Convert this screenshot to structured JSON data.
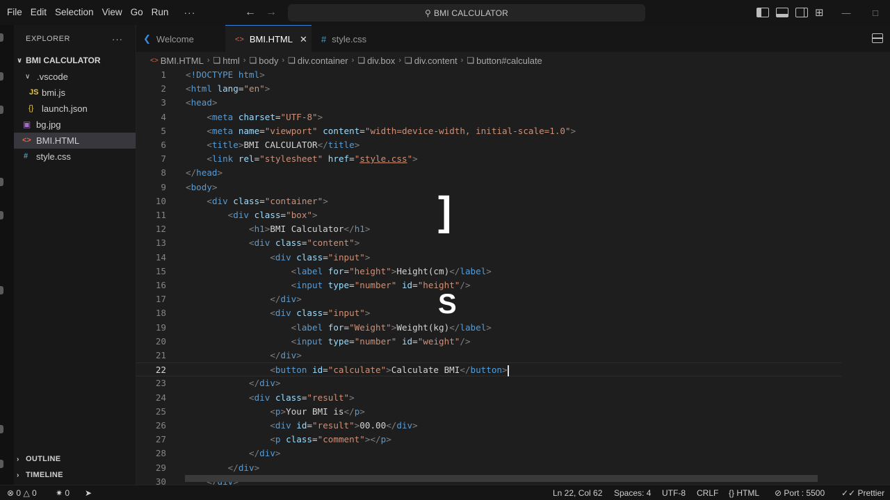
{
  "titlebar": {
    "menu": [
      "File",
      "Edit",
      "Selection",
      "View",
      "Go",
      "Run"
    ],
    "more": "···",
    "command_center": "BMI CALCULATOR"
  },
  "sidebar": {
    "title": "EXPLORER",
    "more": "···",
    "project": "BMI CALCULATOR",
    "items": [
      {
        "label": ".vscode",
        "icon": "chevron-down-icon",
        "indent": 1
      },
      {
        "label": "bmi.js",
        "icon": "js-file-icon",
        "badge": "JS",
        "indent": 2
      },
      {
        "label": "launch.json",
        "icon": "json-file-icon",
        "badge": "{}",
        "indent": 2
      },
      {
        "label": "bg.jpg",
        "icon": "image-file-icon",
        "badge": "▣",
        "indent": 1
      },
      {
        "label": "BMI.HTML",
        "icon": "html-file-icon",
        "badge": "<>",
        "indent": 1,
        "active": true
      },
      {
        "label": "style.css",
        "icon": "css-file-icon",
        "badge": "#",
        "indent": 1
      }
    ],
    "outline": "OUTLINE",
    "timeline": "TIMELINE"
  },
  "tabs": [
    {
      "label": "Welcome",
      "icon": "vscode-icon"
    },
    {
      "label": "BMI.HTML",
      "icon": "html-file-icon",
      "active": true,
      "close": "✕"
    },
    {
      "label": "style.css",
      "icon": "css-file-icon"
    }
  ],
  "breadcrumb": [
    "BMI.HTML",
    "html",
    "body",
    "div.container",
    "div.box",
    "div.content",
    "button#calculate"
  ],
  "editor": {
    "current_line": 22,
    "overlay_glyphs": [
      "]",
      "S"
    ],
    "lines": [
      {
        "n": "1",
        "tokens": [
          [
            "pun",
            "<"
          ],
          [
            "tag",
            "!DOCTYPE "
          ],
          [
            "kw",
            "html"
          ],
          [
            "pun",
            ">"
          ]
        ]
      },
      {
        "n": "2",
        "tokens": [
          [
            "pun",
            "<"
          ],
          [
            "tag",
            "html "
          ],
          [
            "attr",
            "lang"
          ],
          [
            "txt",
            "="
          ],
          [
            "str",
            "\"en\""
          ],
          [
            "pun",
            ">"
          ]
        ]
      },
      {
        "n": "3",
        "tokens": [
          [
            "pun",
            "<"
          ],
          [
            "tag",
            "head"
          ],
          [
            "pun",
            ">"
          ]
        ]
      },
      {
        "n": "4",
        "tokens": [
          [
            "txt",
            "    "
          ],
          [
            "pun",
            "<"
          ],
          [
            "tag",
            "meta "
          ],
          [
            "attr",
            "charset"
          ],
          [
            "txt",
            "="
          ],
          [
            "str",
            "\"UTF-8\""
          ],
          [
            "pun",
            ">"
          ]
        ]
      },
      {
        "n": "5",
        "tokens": [
          [
            "txt",
            "    "
          ],
          [
            "pun",
            "<"
          ],
          [
            "tag",
            "meta "
          ],
          [
            "attr",
            "name"
          ],
          [
            "txt",
            "="
          ],
          [
            "str",
            "\"viewport\" "
          ],
          [
            "attr",
            "content"
          ],
          [
            "txt",
            "="
          ],
          [
            "str",
            "\"width=device-width, initial-scale=1.0\""
          ],
          [
            "pun",
            ">"
          ]
        ]
      },
      {
        "n": "6",
        "tokens": [
          [
            "txt",
            "    "
          ],
          [
            "pun",
            "<"
          ],
          [
            "tag",
            "title"
          ],
          [
            "pun",
            ">"
          ],
          [
            "txt",
            "BMI CALCULATOR"
          ],
          [
            "pun",
            "</"
          ],
          [
            "tag",
            "title"
          ],
          [
            "pun",
            ">"
          ]
        ]
      },
      {
        "n": "7",
        "tokens": [
          [
            "txt",
            "    "
          ],
          [
            "pun",
            "<"
          ],
          [
            "tag",
            "link "
          ],
          [
            "attr",
            "rel"
          ],
          [
            "txt",
            "="
          ],
          [
            "str",
            "\"stylesheet\" "
          ],
          [
            "attr",
            "href"
          ],
          [
            "txt",
            "="
          ],
          [
            "str",
            "\""
          ],
          [
            "link",
            "style.css"
          ],
          [
            "str",
            "\""
          ],
          [
            "pun",
            ">"
          ]
        ]
      },
      {
        "n": "8",
        "tokens": [
          [
            "pun",
            "</"
          ],
          [
            "tag",
            "head"
          ],
          [
            "pun",
            ">"
          ]
        ]
      },
      {
        "n": "9",
        "tokens": [
          [
            "pun",
            "<"
          ],
          [
            "tag",
            "body"
          ],
          [
            "pun",
            ">"
          ]
        ]
      },
      {
        "n": "10",
        "tokens": [
          [
            "txt",
            "    "
          ],
          [
            "pun",
            "<"
          ],
          [
            "tag",
            "div "
          ],
          [
            "attr",
            "class"
          ],
          [
            "txt",
            "="
          ],
          [
            "str",
            "\"container\""
          ],
          [
            "pun",
            ">"
          ]
        ]
      },
      {
        "n": "11",
        "tokens": [
          [
            "txt",
            "        "
          ],
          [
            "pun",
            "<"
          ],
          [
            "tag",
            "div "
          ],
          [
            "attr",
            "class"
          ],
          [
            "txt",
            "="
          ],
          [
            "str",
            "\"box\""
          ],
          [
            "pun",
            ">"
          ]
        ]
      },
      {
        "n": "12",
        "tokens": [
          [
            "txt",
            "            "
          ],
          [
            "pun",
            "<"
          ],
          [
            "tag",
            "h1"
          ],
          [
            "pun",
            ">"
          ],
          [
            "txt",
            "BMI Calculator"
          ],
          [
            "pun",
            "</"
          ],
          [
            "tag",
            "h1"
          ],
          [
            "pun",
            ">"
          ]
        ]
      },
      {
        "n": "13",
        "tokens": [
          [
            "txt",
            "            "
          ],
          [
            "pun",
            "<"
          ],
          [
            "tag",
            "div "
          ],
          [
            "attr",
            "class"
          ],
          [
            "txt",
            "="
          ],
          [
            "str",
            "\"content\""
          ],
          [
            "pun",
            ">"
          ]
        ]
      },
      {
        "n": "14",
        "tokens": [
          [
            "txt",
            "                "
          ],
          [
            "pun",
            "<"
          ],
          [
            "tag",
            "div "
          ],
          [
            "attr",
            "class"
          ],
          [
            "txt",
            "="
          ],
          [
            "str",
            "\"input\""
          ],
          [
            "pun",
            ">"
          ]
        ]
      },
      {
        "n": "15",
        "tokens": [
          [
            "txt",
            "                    "
          ],
          [
            "pun",
            "<"
          ],
          [
            "tag",
            "label "
          ],
          [
            "attr",
            "for"
          ],
          [
            "txt",
            "="
          ],
          [
            "str",
            "\"height\""
          ],
          [
            "pun",
            ">"
          ],
          [
            "txt",
            "Height(cm)"
          ],
          [
            "pun",
            "</"
          ],
          [
            "tag",
            "label"
          ],
          [
            "pun",
            ">"
          ]
        ]
      },
      {
        "n": "16",
        "tokens": [
          [
            "txt",
            "                    "
          ],
          [
            "pun",
            "<"
          ],
          [
            "tag",
            "input "
          ],
          [
            "attr",
            "type"
          ],
          [
            "txt",
            "="
          ],
          [
            "str",
            "\"number\" "
          ],
          [
            "attr",
            "id"
          ],
          [
            "txt",
            "="
          ],
          [
            "str",
            "\"height\""
          ],
          [
            "pun",
            "/>"
          ]
        ]
      },
      {
        "n": "17",
        "tokens": [
          [
            "txt",
            "                "
          ],
          [
            "pun",
            "</"
          ],
          [
            "tag",
            "div"
          ],
          [
            "pun",
            ">"
          ]
        ]
      },
      {
        "n": "18",
        "tokens": [
          [
            "txt",
            "                "
          ],
          [
            "pun",
            "<"
          ],
          [
            "tag",
            "div "
          ],
          [
            "attr",
            "class"
          ],
          [
            "txt",
            "="
          ],
          [
            "str",
            "\"input\""
          ],
          [
            "pun",
            ">"
          ]
        ]
      },
      {
        "n": "19",
        "tokens": [
          [
            "txt",
            "                    "
          ],
          [
            "pun",
            "<"
          ],
          [
            "tag",
            "label "
          ],
          [
            "attr",
            "for"
          ],
          [
            "txt",
            "="
          ],
          [
            "str",
            "\"Weight\""
          ],
          [
            "pun",
            ">"
          ],
          [
            "txt",
            "Weight(kg)"
          ],
          [
            "pun",
            "</"
          ],
          [
            "tag",
            "label"
          ],
          [
            "pun",
            ">"
          ]
        ]
      },
      {
        "n": "20",
        "tokens": [
          [
            "txt",
            "                    "
          ],
          [
            "pun",
            "<"
          ],
          [
            "tag",
            "input "
          ],
          [
            "attr",
            "type"
          ],
          [
            "txt",
            "="
          ],
          [
            "str",
            "\"number\" "
          ],
          [
            "attr",
            "id"
          ],
          [
            "txt",
            "="
          ],
          [
            "str",
            "\"weight\""
          ],
          [
            "pun",
            "/>"
          ]
        ]
      },
      {
        "n": "21",
        "tokens": [
          [
            "txt",
            "                "
          ],
          [
            "pun",
            "</"
          ],
          [
            "tag",
            "div"
          ],
          [
            "pun",
            ">"
          ]
        ]
      },
      {
        "n": "22",
        "tokens": [
          [
            "txt",
            "                "
          ],
          [
            "pun",
            "<"
          ],
          [
            "tag",
            "button "
          ],
          [
            "attr",
            "id"
          ],
          [
            "txt",
            "="
          ],
          [
            "str",
            "\"calculate\""
          ],
          [
            "pun",
            ">"
          ],
          [
            "txt",
            "Calculate BMI"
          ],
          [
            "pun",
            "</"
          ],
          [
            "tag",
            "button"
          ],
          [
            "pun",
            ">"
          ]
        ]
      },
      {
        "n": "23",
        "tokens": [
          [
            "txt",
            "            "
          ],
          [
            "pun",
            "</"
          ],
          [
            "tag",
            "div"
          ],
          [
            "pun",
            ">"
          ]
        ]
      },
      {
        "n": "24",
        "tokens": [
          [
            "txt",
            "            "
          ],
          [
            "pun",
            "<"
          ],
          [
            "tag",
            "div "
          ],
          [
            "attr",
            "class"
          ],
          [
            "txt",
            "="
          ],
          [
            "str",
            "\"result\""
          ],
          [
            "pun",
            ">"
          ]
        ]
      },
      {
        "n": "25",
        "tokens": [
          [
            "txt",
            "                "
          ],
          [
            "pun",
            "<"
          ],
          [
            "tag",
            "p"
          ],
          [
            "pun",
            ">"
          ],
          [
            "txt",
            "Your BMI is"
          ],
          [
            "pun",
            "</"
          ],
          [
            "tag",
            "p"
          ],
          [
            "pun",
            ">"
          ]
        ]
      },
      {
        "n": "26",
        "tokens": [
          [
            "txt",
            "                "
          ],
          [
            "pun",
            "<"
          ],
          [
            "tag",
            "div "
          ],
          [
            "attr",
            "id"
          ],
          [
            "txt",
            "="
          ],
          [
            "str",
            "\"result\""
          ],
          [
            "pun",
            ">"
          ],
          [
            "txt",
            "00.00"
          ],
          [
            "pun",
            "</"
          ],
          [
            "tag",
            "div"
          ],
          [
            "pun",
            ">"
          ]
        ]
      },
      {
        "n": "27",
        "tokens": [
          [
            "txt",
            "                "
          ],
          [
            "pun",
            "<"
          ],
          [
            "tag",
            "p "
          ],
          [
            "attr",
            "class"
          ],
          [
            "txt",
            "="
          ],
          [
            "str",
            "\"comment\""
          ],
          [
            "pun",
            "></"
          ],
          [
            "tag",
            "p"
          ],
          [
            "pun",
            ">"
          ]
        ]
      },
      {
        "n": "28",
        "tokens": [
          [
            "txt",
            "            "
          ],
          [
            "pun",
            "</"
          ],
          [
            "tag",
            "div"
          ],
          [
            "pun",
            ">"
          ]
        ]
      },
      {
        "n": "29",
        "tokens": [
          [
            "txt",
            "        "
          ],
          [
            "pun",
            "</"
          ],
          [
            "tag",
            "div"
          ],
          [
            "pun",
            ">"
          ]
        ]
      },
      {
        "n": "30",
        "tokens": [
          [
            "txt",
            "    "
          ],
          [
            "pun",
            "</"
          ],
          [
            "tag",
            "div"
          ],
          [
            "pun",
            ">"
          ]
        ]
      }
    ]
  },
  "statusbar": {
    "errors": "0",
    "warnings": "0",
    "ports": "0",
    "position": "Ln 22, Col 62",
    "spaces": "Spaces: 4",
    "encoding": "UTF-8",
    "eol": "CRLF",
    "language": "HTML",
    "port": "Port : 5500",
    "prettier": "Prettier"
  },
  "colors": {
    "tag": "#569cd6",
    "attr": "#9cdcfe",
    "string": "#ce9178",
    "text": "#d4d4d4",
    "punctuation": "#808080",
    "html_icon": "#e2664a",
    "css_icon": "#519aba",
    "js_icon": "#e8c547",
    "active_tab_border": "#3c7fd6"
  }
}
